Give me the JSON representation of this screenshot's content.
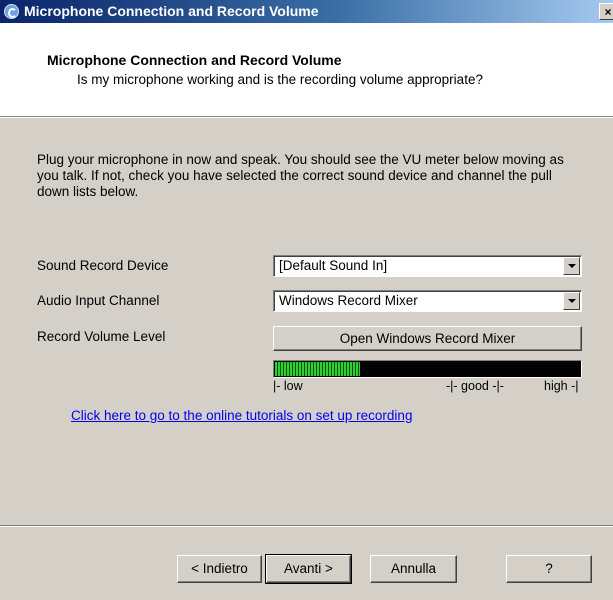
{
  "window": {
    "title": "Microphone Connection and Record Volume",
    "close_glyph": "×"
  },
  "header": {
    "title": "Microphone Connection and Record Volume",
    "subtitle": "Is my microphone working and is the recording volume appropriate?"
  },
  "instructions": "Plug your microphone in now and speak. You should see the VU meter below moving as you talk. If not, check you have selected the correct sound device and channel the pull down lists below.",
  "fields": {
    "sound_record_device": {
      "label": "Sound Record Device",
      "value": "[Default Sound In]"
    },
    "audio_input_channel": {
      "label": "Audio Input Channel",
      "value": "Windows Record Mixer"
    },
    "record_volume_level": {
      "label": "Record Volume Level",
      "button_label": "Open Windows Record Mixer"
    }
  },
  "vu_meter": {
    "level": 0.28,
    "scale_low": "|- low",
    "scale_good": "-|-  good  -|-",
    "scale_high": "high -|"
  },
  "link_text": "Click here to go to the online tutorials on set up recording",
  "footer": {
    "back_label": "< Indietro",
    "next_label": "Avanti >",
    "cancel_label": "Annulla",
    "help_label": "?"
  },
  "icons": {
    "app": "app-logo-icon",
    "close": "close-icon",
    "dropdown": "chevron-down-icon"
  }
}
